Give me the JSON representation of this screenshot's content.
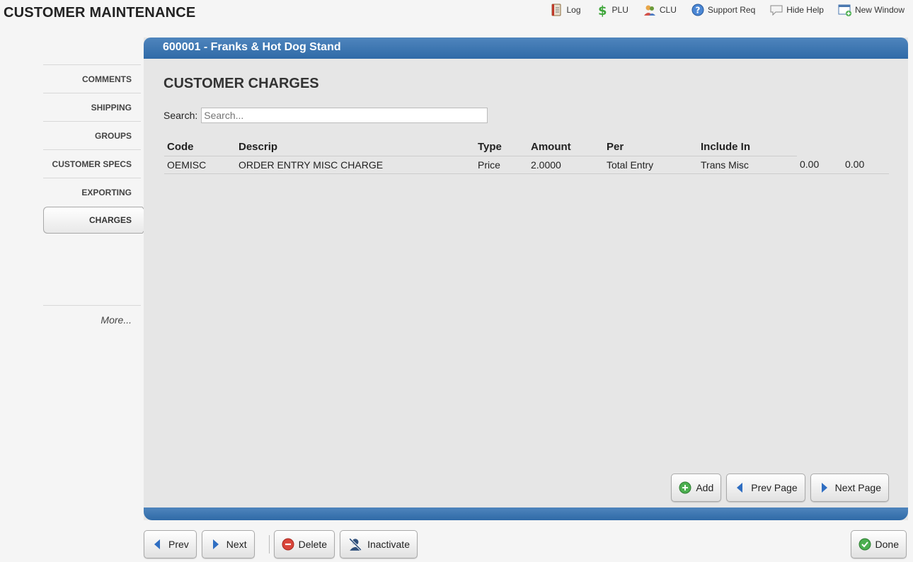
{
  "app": {
    "title": "CUSTOMER MAINTENANCE"
  },
  "toolbar": [
    {
      "name": "log",
      "label": "Log",
      "icon": "notebook-icon"
    },
    {
      "name": "plu",
      "label": "PLU",
      "icon": "dollar-icon"
    },
    {
      "name": "clu",
      "label": "CLU",
      "icon": "users-icon"
    },
    {
      "name": "support",
      "label": "Support Req",
      "icon": "help-icon"
    },
    {
      "name": "hide-help",
      "label": "Hide Help",
      "icon": "speech-bubble-icon"
    },
    {
      "name": "new-window",
      "label": "New Window",
      "icon": "new-window-icon"
    }
  ],
  "sidebar": {
    "items": [
      {
        "label": "COMMENTS"
      },
      {
        "label": "SHIPPING"
      },
      {
        "label": "GROUPS"
      },
      {
        "label": "CUSTOMER SPECS"
      },
      {
        "label": "EXPORTING"
      },
      {
        "label": "CHARGES",
        "active": true
      }
    ],
    "more_label": "More..."
  },
  "panel": {
    "header": "600001 - Franks & Hot Dog Stand",
    "section_title": "CUSTOMER CHARGES",
    "search_label": "Search:",
    "search_placeholder": "Search...",
    "search_value": ""
  },
  "table": {
    "columns": [
      "Code",
      "Descrip",
      "Type",
      "Amount",
      "Per",
      "Include In",
      "",
      ""
    ],
    "rows": [
      [
        "OEMISC",
        "ORDER ENTRY MISC CHARGE",
        "Price",
        "2.0000",
        "Total Entry",
        "Trans Misc",
        "0.00",
        "0.00"
      ]
    ]
  },
  "panel_buttons": {
    "add": "Add",
    "prev_page": "Prev Page",
    "next_page": "Next Page"
  },
  "bottom_buttons": {
    "prev": "Prev",
    "next": "Next",
    "delete": "Delete",
    "inactivate": "Inactivate",
    "done": "Done"
  },
  "colors": {
    "header_blue": "#3a73b0",
    "add_green": "#4caf50",
    "delete_red": "#d9453a",
    "nav_arrow_blue": "#2f6ec2"
  }
}
